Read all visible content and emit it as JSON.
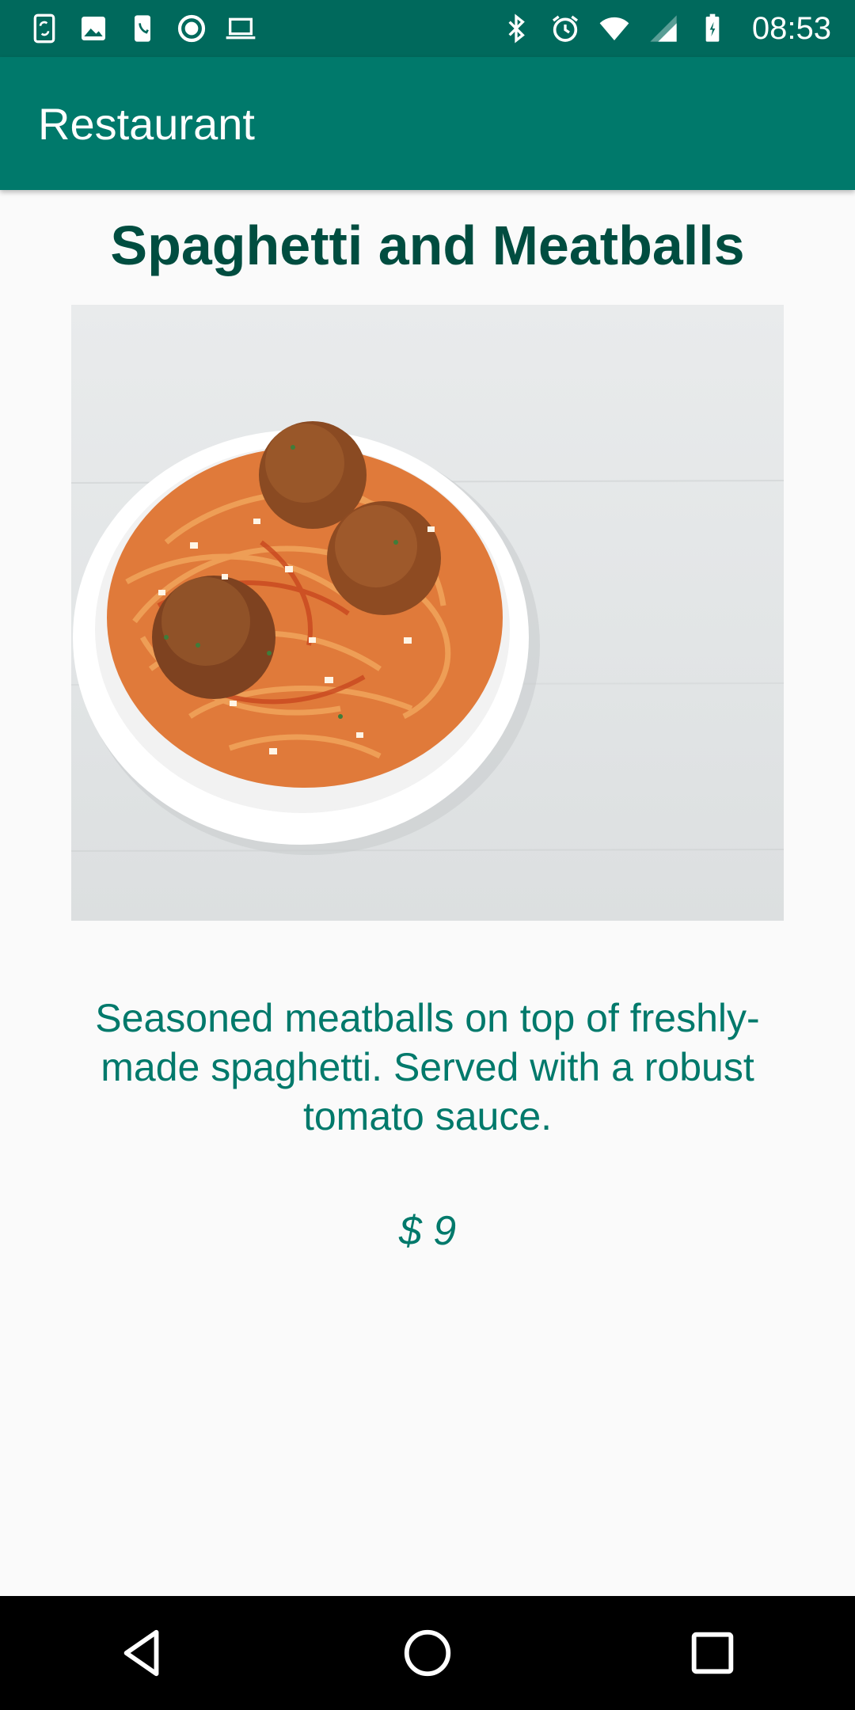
{
  "status_bar": {
    "left_icons": [
      "phone-sync-icon",
      "image-icon",
      "phone-icon",
      "record-icon",
      "laptop-icon"
    ],
    "right_icons": [
      "bluetooth-icon",
      "alarm-icon",
      "wifi-icon",
      "signal-icon",
      "battery-icon"
    ],
    "time": "08:53"
  },
  "app_bar": {
    "title": "Restaurant"
  },
  "dish": {
    "name": "Spaghetti and Meatballs",
    "image_icon": "spaghetti-meatballs-photo",
    "description": "Seasoned meatballs on top of freshly-made spaghetti. Served with a robust tomato sauce.",
    "price": "$ 9"
  },
  "nav_bar": {
    "buttons": [
      "back-icon",
      "home-icon",
      "recents-icon"
    ]
  },
  "colors": {
    "status_bar": "#00695c",
    "app_bar": "#00796b",
    "title_text": "#004d40",
    "accent_text": "#00796b",
    "background": "#fafafa"
  }
}
